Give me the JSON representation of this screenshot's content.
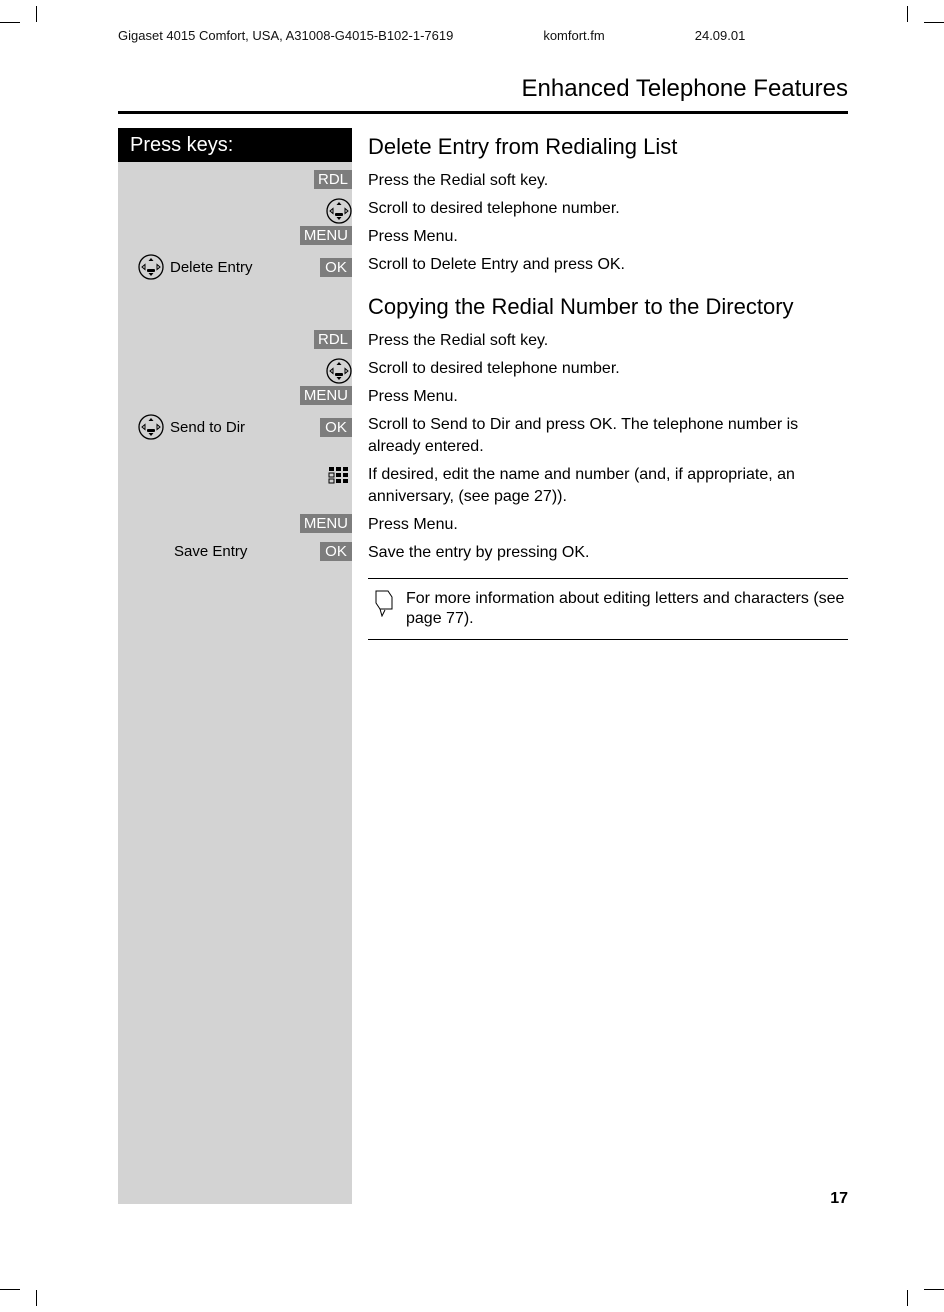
{
  "meta": {
    "product": "Gigaset 4015 Comfort, USA, A31008-G4015-B102-1-7619",
    "file": "komfort.fm",
    "date": "24.09.01"
  },
  "section_title": "Enhanced Telephone Features",
  "press_keys_label": "Press keys:",
  "softkeys": {
    "rdl": "RDL",
    "menu": "MENU",
    "ok": "OK"
  },
  "menu_labels": {
    "delete_entry": "Delete Entry",
    "send_to_dir": "Send to Dir",
    "save_entry": "Save Entry"
  },
  "section_a": {
    "heading": "Delete Entry from Redialing List",
    "r1": "Press the Redial soft key.",
    "r2": "Scroll to desired telephone number.",
    "r3": "Press Menu.",
    "r4": "Scroll to Delete Entry and press OK."
  },
  "section_b": {
    "heading": "Copying the Redial Number to the Directory",
    "r1": "Press the Redial soft key.",
    "r2": "Scroll to desired telephone number.",
    "r3": "Press Menu.",
    "r4": "Scroll to Send to Dir and press OK. The telephone number is already entered.",
    "r5": "If desired, edit the name and number (and, if appropriate, an anniversary, (see page 27)).",
    "r6": "Press Menu.",
    "r7": "Save the entry by pressing OK."
  },
  "note": "For more information about editing letters and characters (see page 77).",
  "page_number": "17"
}
